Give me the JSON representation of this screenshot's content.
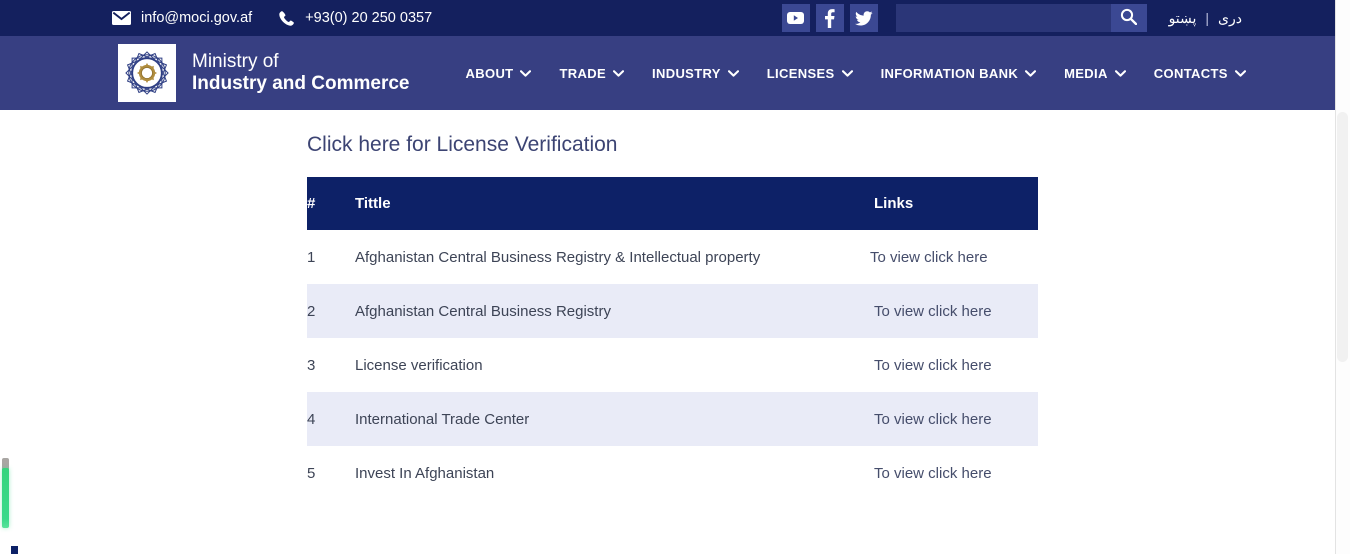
{
  "theme": {
    "topbar_bg": "#14205e",
    "navbar_bg": "#373f82",
    "table_header_bg": "#0d2167",
    "row_alt_bg": "#e9ebf7",
    "accent_green": "#36d47d",
    "text_light": "#ffffff"
  },
  "topbar": {
    "email": "info@moci.gov.af",
    "phone": "+93(0) 20 250 0357",
    "social": [
      {
        "name": "youtube",
        "label": "YouTube"
      },
      {
        "name": "facebook",
        "label": "Facebook"
      },
      {
        "name": "twitter",
        "label": "Twitter"
      }
    ],
    "search": {
      "value": "",
      "placeholder": "",
      "button_label": "Search"
    },
    "languages": {
      "pashto": "پښتو",
      "separator": "|",
      "dari": "دری"
    }
  },
  "brand": {
    "line1": "Ministry of",
    "line2": "Industry and Commerce",
    "logo_name": "ministry-seal-logo"
  },
  "nav": {
    "items": [
      {
        "label": "ABOUT",
        "has_dropdown": true
      },
      {
        "label": "TRADE",
        "has_dropdown": true
      },
      {
        "label": "INDUSTRY",
        "has_dropdown": true
      },
      {
        "label": "LICENSES",
        "has_dropdown": true
      },
      {
        "label": "INFORMATION BANK",
        "has_dropdown": true
      },
      {
        "label": "MEDIA",
        "has_dropdown": true
      },
      {
        "label": "CONTACTS",
        "has_dropdown": true
      }
    ]
  },
  "main": {
    "heading": "Click here for License Verification",
    "table": {
      "columns": [
        "#",
        "Tittle",
        "Links"
      ],
      "rows": [
        {
          "num": "1",
          "title": "Afghanistan Central Business Registry & Intellectual property",
          "link": "To view click here"
        },
        {
          "num": "2",
          "title": "Afghanistan Central Business Registry",
          "link": "To view click here"
        },
        {
          "num": "3",
          "title": "License verification",
          "link": "To view click here"
        },
        {
          "num": "4",
          "title": "International Trade Center",
          "link": "To view click here"
        },
        {
          "num": "5",
          "title": "Invest In Afghanistan",
          "link": "To view click here"
        }
      ]
    }
  }
}
